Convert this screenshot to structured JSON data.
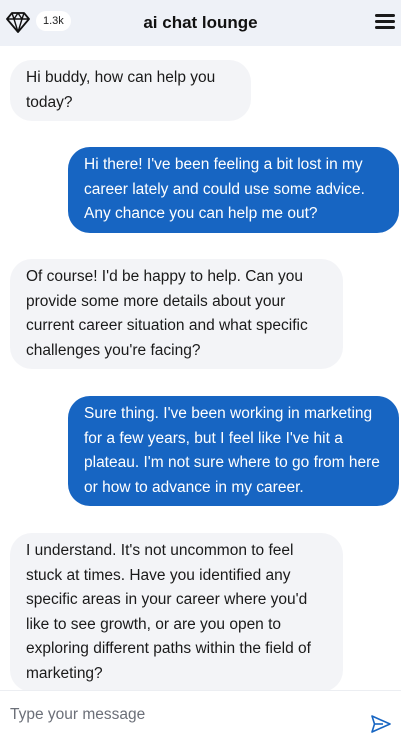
{
  "header": {
    "title": "ai chat lounge",
    "badge": "1.3k",
    "left_icon": "gem-icon",
    "right_icon": "menu-icon"
  },
  "messages": [
    {
      "role": "bot",
      "text": "Hi buddy, how can help you today?"
    },
    {
      "role": "user",
      "text": "Hi there! I've been feeling a bit lost in my career lately and could use some advice. Any chance you can help me out?"
    },
    {
      "role": "bot",
      "text": "Of course! I'd be happy to help. Can you provide some more details about your current career situation and what specific challenges you're facing?"
    },
    {
      "role": "user",
      "text": "Sure thing. I've been working in marketing for a few years, but I feel like I've hit a plateau. I'm not sure where to go from here or how to advance in my career."
    },
    {
      "role": "bot",
      "text": "I understand. It's not uncommon to feel stuck at times. Have you identified any specific areas in your career where you'd like to see growth, or are you open to exploring different paths within the field of marketing?"
    }
  ],
  "composer": {
    "placeholder": "Type your message",
    "send_icon": "send-icon"
  },
  "colors": {
    "header_bg": "#eef1f7",
    "user_bubble": "#1765c2",
    "bot_bubble": "#f3f4f7"
  }
}
